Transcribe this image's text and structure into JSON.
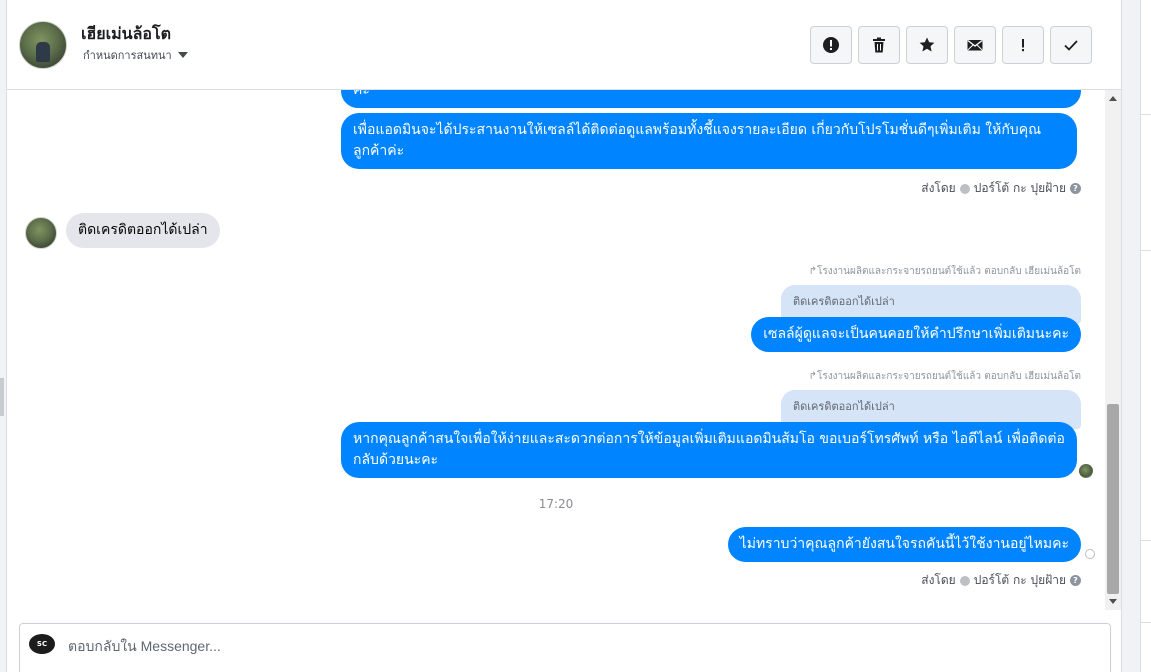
{
  "header": {
    "name": "เฮียเม่นล้อโต",
    "assign_label": "กำหนดการสนทนา"
  },
  "toolbar": {
    "buttons": [
      {
        "name": "spam-icon",
        "label": "Mark as spam"
      },
      {
        "name": "trash-icon",
        "label": "Delete"
      },
      {
        "name": "star-icon",
        "label": "Star"
      },
      {
        "name": "envelope-icon",
        "label": "Mark as unread"
      },
      {
        "name": "exclamation-icon",
        "label": "Follow up"
      },
      {
        "name": "check-icon",
        "label": "Done"
      }
    ]
  },
  "messages": {
    "m1_text": "ค่ะ",
    "m2_text": "เพื่อแอดมินจะได้ประสานงานให้เซลล์ได้ติดต่อดูแลพร้อมทั้งชี้แจงรายละเอียด เกี่ยวกับโปรโมชั่นดีๆเพิ่มเติม ให้กับคุณลูกค้าค่ะ",
    "sent_by_1": "ส่งโดย",
    "sender_1": "ปอร์โต้ กะ ปุยฝ้าย",
    "incoming_text": "ติดเครดิตออกได้เปล่า",
    "reply_meta_1": "↱โรงงานผลิตและกระจายรถยนต์ใช้แล้ว ตอบกลับ เฮียเม่นล้อโต",
    "quote_1": "ติดเครดิตออกได้เปล่า",
    "m3_text": "เซลล์ผู้ดูแลจะเป็นคนคอยให้คำปรึกษาเพิ่มเติมนะคะ",
    "reply_meta_2": "↱โรงงานผลิตและกระจายรถยนต์ใช้แล้ว ตอบกลับ เฮียเม่นล้อโต",
    "quote_2": "ติดเครดิตออกได้เปล่า",
    "m4_text": "หากคุณลูกค้าสนใจเพื่อให้ง่ายและสะดวกต่อการให้ข้อมูลเพิ่มเติมแอดมินส้มโอ ขอเบอร์โทรศัพท์ หรือ ไอดีไลน์ เพื่อติดต่อกลับด้วยนะคะ",
    "timestamp": "17:20",
    "m5_text": "ไม่ทราบว่าคุณลูกค้ายังสนใจรถคันนี้ไว้ใช้งานอยู่ไหมคะ",
    "sent_by_2": "ส่งโดย",
    "sender_2": "ปอร์โต้ กะ ปุยฝ้าย"
  },
  "composer": {
    "avatar_text": "SC",
    "placeholder": "ตอบกลับใน Messenger..."
  },
  "colors": {
    "outgoing_bubble": "#0084ff",
    "incoming_bubble": "#e4e6eb",
    "quote_bubble": "#d6e4f7"
  }
}
